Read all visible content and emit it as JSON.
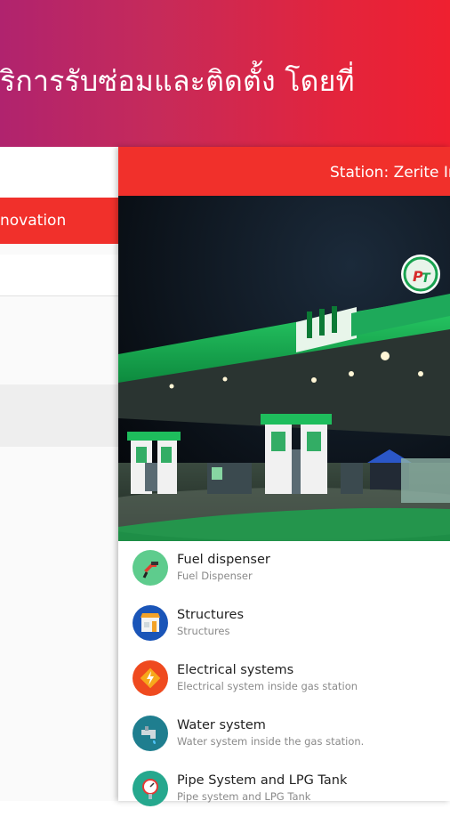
{
  "banner": {
    "headline": "ริการรับซ่อมและติดตั้ง โดยที่"
  },
  "back_card": {
    "bar_text": "novation"
  },
  "card": {
    "title": "Station: Zerite In",
    "photo_alt": "gas station at night",
    "items": [
      {
        "title": "Fuel dispenser",
        "subtitle": "Fuel Dispenser",
        "icon": "fuel-nozzle-icon",
        "color": "#5ecc8d"
      },
      {
        "title": "Structures",
        "subtitle": "Structures",
        "icon": "store-building-icon",
        "color": "#1a55b8"
      },
      {
        "title": "Electrical systems",
        "subtitle": "Electrical system inside gas station",
        "icon": "lightning-icon",
        "color": "#ef4a1f"
      },
      {
        "title": "Water system",
        "subtitle": "Water system inside the gas station.",
        "icon": "water-faucet-icon",
        "color": "#1f7e8f"
      },
      {
        "title": "Pipe System and LPG Tank",
        "subtitle": "Pipe system and LPG Tank",
        "icon": "pressure-gauge-icon",
        "color": "#26a88e"
      }
    ]
  },
  "colors": {
    "accent_red": "#f1302b",
    "banner_start": "#b0236e",
    "banner_end": "#ef2030"
  }
}
